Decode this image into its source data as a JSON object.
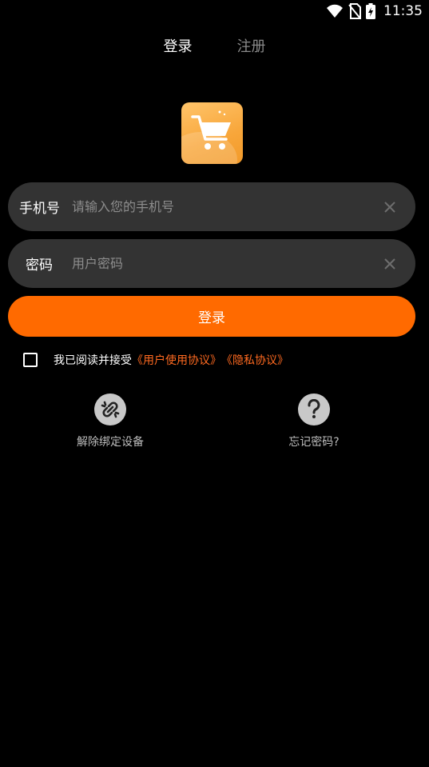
{
  "status_bar": {
    "time": "11:35",
    "icons": [
      "wifi-icon",
      "no-sim-icon",
      "battery-charging-icon"
    ]
  },
  "tabs": [
    {
      "label": "登录",
      "active": true
    },
    {
      "label": "注册",
      "active": false
    }
  ],
  "logo": {
    "icon": "shopping-cart-icon",
    "colors": [
      "#ffc46a",
      "#f29a2a"
    ]
  },
  "form": {
    "phone": {
      "label": "手机号",
      "placeholder": "请输入您的手机号",
      "value": ""
    },
    "password": {
      "label": "密码",
      "placeholder": "用户密码",
      "value": ""
    },
    "submit_label": "登录"
  },
  "agreement": {
    "checked": false,
    "text": "我已阅读并接受",
    "user_agreement": "《用户使用协议》",
    "privacy_policy": "《隐私协议》"
  },
  "actions": {
    "unbind": {
      "label": "解除绑定设备",
      "icon": "broken-link-icon"
    },
    "forgot": {
      "label": "忘记密码?",
      "icon": "question-icon"
    }
  },
  "colors": {
    "accent": "#ff6a00",
    "link": "#ff6a20",
    "field_bg": "#333333",
    "background": "#000000"
  }
}
